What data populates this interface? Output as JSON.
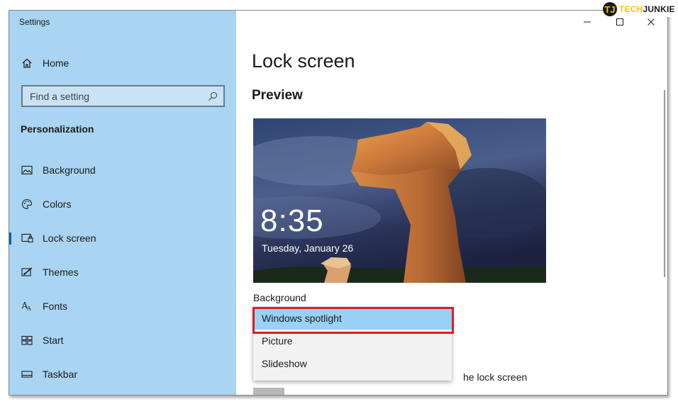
{
  "window": {
    "title": "Settings"
  },
  "sidebar": {
    "home_label": "Home",
    "search_placeholder": "Find a setting",
    "section_title": "Personalization",
    "items": [
      {
        "label": "Background",
        "icon": "picture-icon",
        "selected": false
      },
      {
        "label": "Colors",
        "icon": "palette-icon",
        "selected": false
      },
      {
        "label": "Lock screen",
        "icon": "lock-screen-icon",
        "selected": true
      },
      {
        "label": "Themes",
        "icon": "themes-icon",
        "selected": false
      },
      {
        "label": "Fonts",
        "icon": "fonts-icon",
        "selected": false
      },
      {
        "label": "Start",
        "icon": "start-icon",
        "selected": false
      },
      {
        "label": "Taskbar",
        "icon": "taskbar-icon",
        "selected": false
      }
    ]
  },
  "main": {
    "page_title": "Lock screen",
    "preview_title": "Preview",
    "preview": {
      "time": "8:35",
      "date": "Tuesday, January 26"
    },
    "background_label": "Background",
    "partially_covered_text": "he lock screen"
  },
  "dropdown": {
    "options": [
      "Windows spotlight",
      "Picture",
      "Slideshow"
    ],
    "selected_index": 0
  },
  "watermark": {
    "brand_first": "TECH",
    "brand_second": "JUNKIE",
    "badge": "TJ"
  },
  "colors": {
    "sidebar_bg": "#a9d4f2",
    "accent": "#0063b1",
    "highlight_border": "#e21a22",
    "selected_option_bg": "#99d1f7",
    "brand_yellow": "#f7c300"
  }
}
